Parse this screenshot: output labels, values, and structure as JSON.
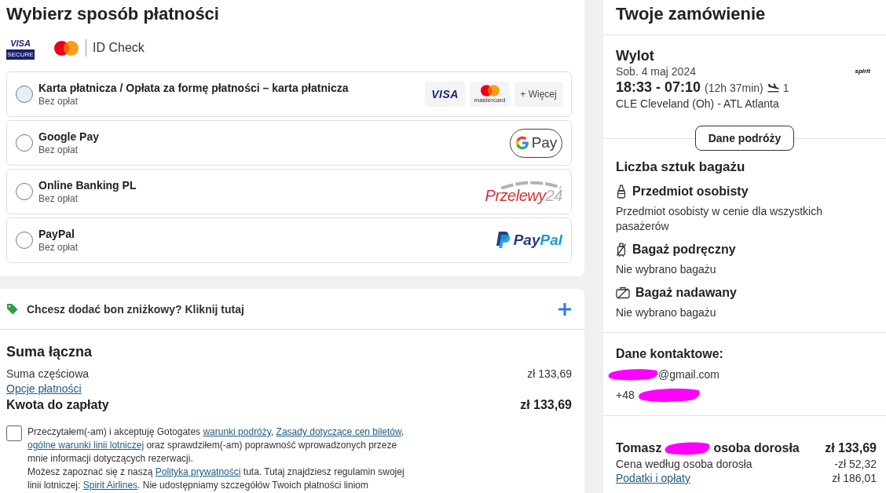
{
  "payment_methods": {
    "title": "Wybierz sposób płatności",
    "security_logos": [
      {
        "kind": "visa_secure",
        "brand": "VISA",
        "caption": "SECURE"
      },
      {
        "kind": "mastercard_id_check",
        "caption": "ID Check"
      }
    ],
    "options": [
      {
        "name": "Karta płatnicza / Opłata za formę płatności – karta płatnicza",
        "fee": "Bez opłat",
        "selected": false,
        "hovered": true,
        "logos": [
          {
            "kind": "visa",
            "text": "VISA"
          },
          {
            "kind": "mastercard",
            "text": "mastercard"
          },
          {
            "kind": "more",
            "text": "+ Więcej"
          }
        ]
      },
      {
        "name": "Google Pay",
        "fee": "Bez opłat",
        "selected": false,
        "hovered": false,
        "logos": [
          {
            "kind": "google_pay",
            "text": "Pay"
          }
        ]
      },
      {
        "name": "Online Banking PL",
        "fee": "Bez opłat",
        "selected": false,
        "hovered": false,
        "logos": [
          {
            "kind": "przelewy24",
            "parts": [
              "Przelewy",
              "24"
            ]
          }
        ]
      },
      {
        "name": "PayPal",
        "fee": "Bez opłat",
        "selected": false,
        "hovered": false,
        "logos": [
          {
            "kind": "paypal",
            "parts": [
              "Pay",
              "Pal"
            ]
          }
        ]
      }
    ]
  },
  "discount": {
    "text": "Chcesz dodać bon zniżkowy? Kliknij tutaj",
    "expanded": false
  },
  "totals": {
    "title": "Suma łączna",
    "rows": [
      {
        "kind": "line",
        "label": "Suma częściowa",
        "amount": "zł 133,69"
      },
      {
        "kind": "link",
        "label": "Opcje płatności"
      },
      {
        "kind": "total",
        "label": "Kwota do zapłaty",
        "amount": "zł 133,69"
      }
    ]
  },
  "terms": {
    "checked": false,
    "paragraphs": [
      [
        {
          "kind": "text",
          "text": "Przeczytałem(-am) i akceptuję Gotogates "
        },
        {
          "kind": "link",
          "text": "warunki podróży"
        },
        {
          "kind": "text",
          "text": ", "
        },
        {
          "kind": "link",
          "text": "Zasady dotyczące cen biletów"
        },
        {
          "kind": "text",
          "text": ", "
        },
        {
          "kind": "link",
          "text": "ogólne warunki linii lotniczej"
        },
        {
          "kind": "text",
          "text": " oraz sprawdziłem(-am) poprawność wprowadzonych przeze mnie informacji dotyczących rezerwacji."
        }
      ],
      [
        {
          "kind": "text",
          "text": "Możesz zapoznać się z naszą "
        },
        {
          "kind": "link",
          "text": "Polityka prywatności"
        },
        {
          "kind": "text",
          "text": " tuta. Tutaj znajdziesz regulamin swojej linii lotniczej: "
        },
        {
          "kind": "link",
          "text": "Spirit Airlines"
        },
        {
          "kind": "text",
          "text": ". Nie udostępniamy szczegółów Twoich płatności liniom"
        }
      ]
    ]
  },
  "order": {
    "title": "Twoje zamówienie",
    "flight": {
      "title": "Wylot",
      "date": "Sob. 4 maj 2024",
      "airline_logo": "spirit",
      "times": "18:33 - 07:10",
      "duration": "(12h 37min)",
      "stops": "1",
      "route": "CLE Cleveland (Oh) - ATL Atlanta",
      "details_button": "Dane podróży"
    },
    "baggage": {
      "title": "Liczba sztuk bagażu",
      "items": [
        {
          "kind": "personal",
          "name": "Przedmiot osobisty",
          "description": "Przedmiot osobisty w cenie dla wszystkich pasażerów",
          "included": true
        },
        {
          "kind": "cabin",
          "name": "Bagaż podręczny",
          "description": "Nie wybrano bagażu",
          "included": false
        },
        {
          "kind": "checked",
          "name": "Bagaż nadawany",
          "description": "Nie wybrano bagażu",
          "included": false
        }
      ]
    },
    "contact": {
      "title": "Dane kontaktowe:",
      "lines": [
        {
          "kind": "email",
          "text": "@gmail.com",
          "redacted": true
        },
        {
          "kind": "phone",
          "text": "+48",
          "redacted": true
        }
      ]
    },
    "passengers": [
      {
        "first_name": "Tomasz",
        "redacted": true,
        "type": "osoba dorosła",
        "total": "zł 133,69",
        "lines": [
          {
            "kind": "text",
            "label": "Cena według osoba dorosła",
            "amount": "-zł 52,32"
          },
          {
            "kind": "link",
            "label": "Podatki i opłaty",
            "amount": "zł 186,01"
          }
        ]
      }
    ]
  }
}
